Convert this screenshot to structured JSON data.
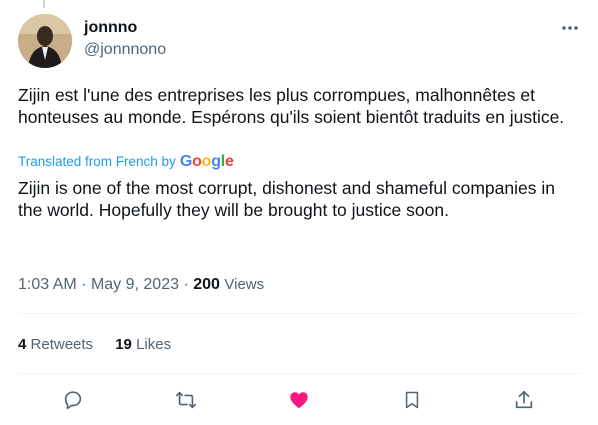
{
  "tweet": {
    "display_name": "jonnno",
    "handle": "@jonnnono",
    "text": "Zijin est l'une des entreprises les plus corrompues, malhonnêtes et honteuses au monde. Espérons qu'ils soient bientôt traduits en justice.",
    "translated_label": "Translated from French by",
    "translator": {
      "g1": "G",
      "o1": "o",
      "o2": "o",
      "g2": "g",
      "l": "l",
      "e": "e"
    },
    "translation": "Zijin is one of the most corrupt, dishonest and shameful companies in the world. Hopefully they will be brought to justice soon.",
    "time": "1:03 AM",
    "date": "May 9, 2023",
    "separator": "·",
    "views_count": "200",
    "views_label": "Views",
    "retweets_count": "4",
    "retweets_label": "Retweets",
    "likes_count": "19",
    "likes_label": "Likes"
  },
  "colors": {
    "accent": "#1d9bf0",
    "like": "#f91880",
    "icon": "#536471",
    "text": "#0f1419"
  },
  "icons": {
    "more": "more-horizontal-icon",
    "reply": "reply-icon",
    "retweet": "retweet-icon",
    "like": "heart-filled-icon",
    "bookmark": "bookmark-icon",
    "share": "share-icon"
  }
}
